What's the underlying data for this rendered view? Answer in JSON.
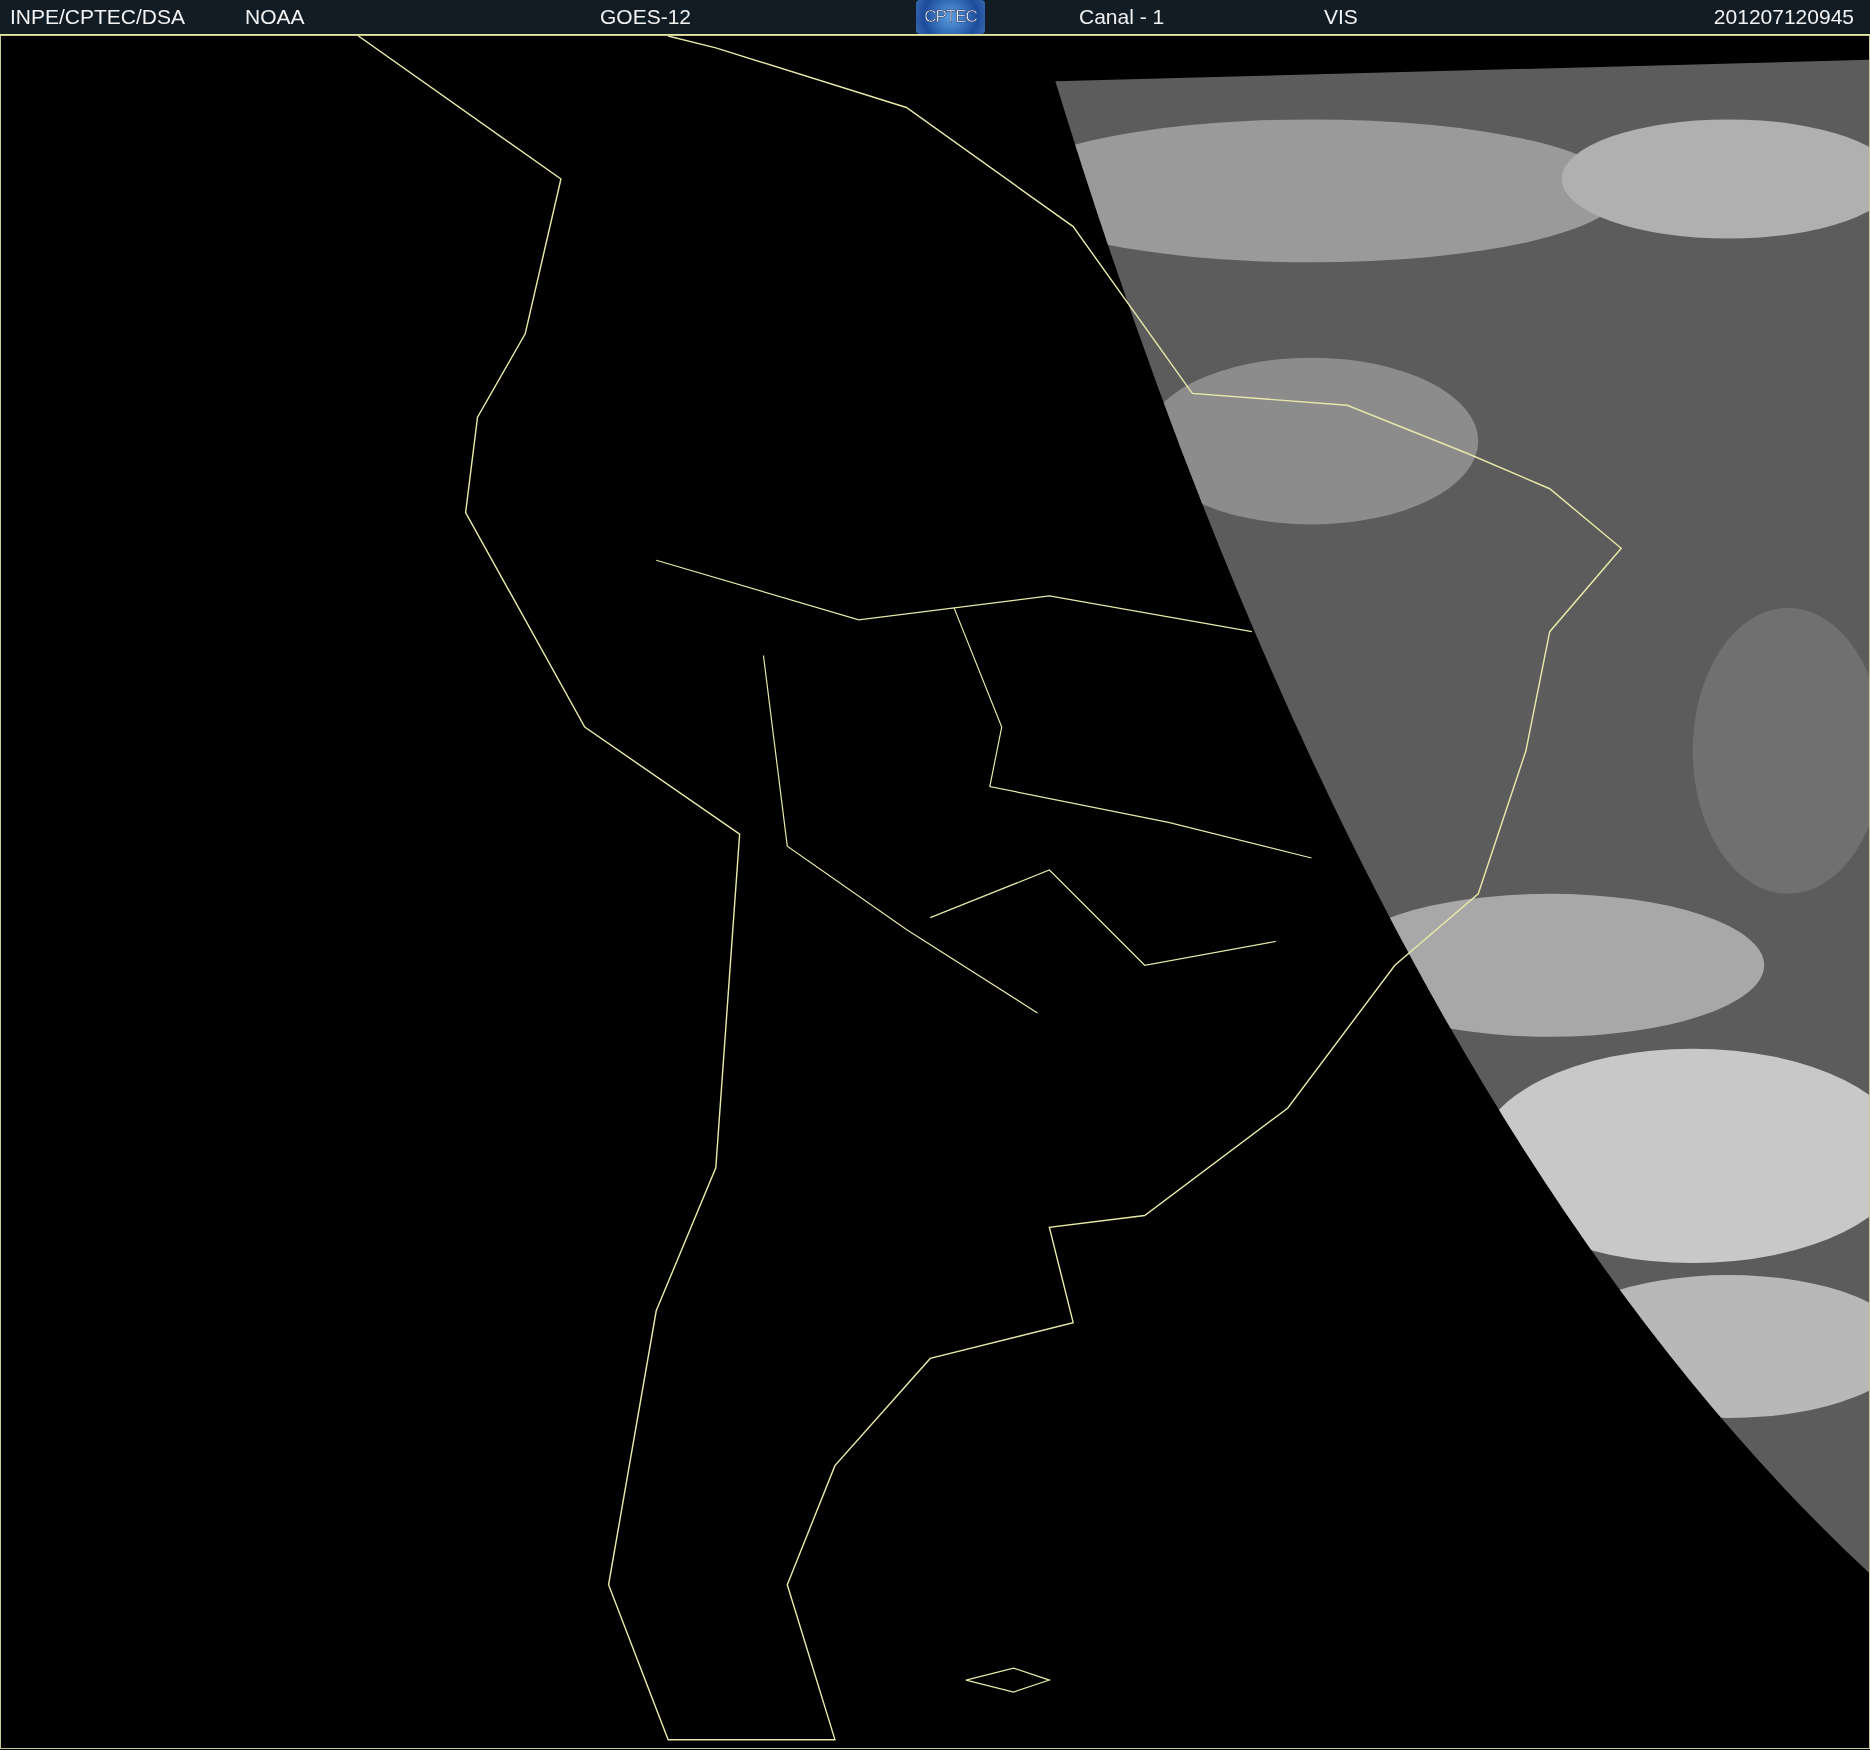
{
  "header": {
    "items": [
      {
        "kind": "text",
        "text": "INPE/CPTEC/DSA"
      },
      {
        "kind": "text",
        "text": "NOAA"
      },
      {
        "kind": "text",
        "text": "GOES-12"
      },
      {
        "kind": "logo",
        "text": "CPTEC"
      },
      {
        "kind": "text",
        "text": "Canal - 1"
      },
      {
        "kind": "text",
        "text": "VIS"
      },
      {
        "kind": "text",
        "text": "201207120945"
      }
    ]
  }
}
